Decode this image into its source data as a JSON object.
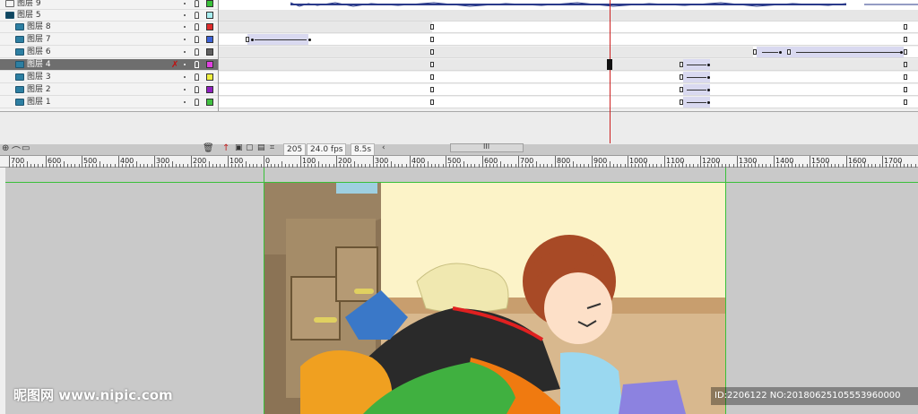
{
  "layers": [
    {
      "name": "图层 9",
      "color": "#38c038"
    },
    {
      "name": "图层 5",
      "color": "#a8eef0"
    },
    {
      "name": "图层 8",
      "color": "#e02c2c"
    },
    {
      "name": "图层 7",
      "color": "#3c62d8"
    },
    {
      "name": "图层 6",
      "color": "#606060"
    },
    {
      "name": "图层 4",
      "color": "#e040e0"
    },
    {
      "name": "图层 3",
      "color": "#f0f040"
    },
    {
      "name": "图层 2",
      "color": "#9020c0"
    },
    {
      "name": "图层 1",
      "color": "#40c040"
    }
  ],
  "timeline_status": {
    "current_frame": "205",
    "fps": "24.0 fps",
    "time": "8.5s"
  },
  "ruler_labels": [
    "700",
    "600",
    "500",
    "400",
    "300",
    "200",
    "100",
    "0",
    "100",
    "200",
    "300",
    "400",
    "500",
    "600",
    "700",
    "800",
    "900",
    "1000",
    "1100",
    "1200",
    "1300",
    "1400",
    "1500",
    "1600",
    "1700"
  ],
  "watermark": "昵图网 www.nipic.com",
  "image_id": "ID:2206122 NO:20180625105553960000"
}
